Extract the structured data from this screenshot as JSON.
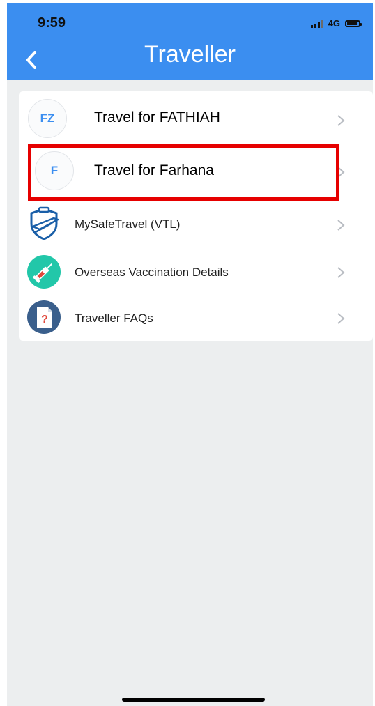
{
  "status_bar": {
    "time": "9:59",
    "network": "4G"
  },
  "header": {
    "title": "Traveller",
    "back_icon": "chevron-left-icon"
  },
  "travellers": [
    {
      "initials": "FZ",
      "name": "Travel for FATHIAH"
    },
    {
      "initials": "F",
      "name": "Travel for Farhana"
    }
  ],
  "menu_items": [
    {
      "label": "MySafeTravel (VTL)",
      "icon": "shield-plane-icon"
    },
    {
      "label": "Overseas Vaccination Details",
      "icon": "syringe-icon"
    },
    {
      "label": "Traveller FAQs",
      "icon": "faq-document-icon"
    }
  ],
  "colors": {
    "header": "#3b8ef0",
    "background": "#eceeef",
    "highlight": "#e60000"
  }
}
